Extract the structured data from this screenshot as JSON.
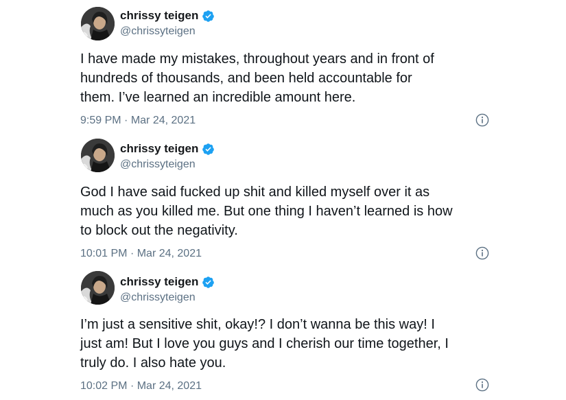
{
  "colors": {
    "verified_badge": "#1da1f2",
    "handle_gray": "#5b7083",
    "text": "#0f1419"
  },
  "tweets": [
    {
      "display_name": "chrissy teigen",
      "handle": "@chrissyteigen",
      "text": "I have made my mistakes, throughout years and in front of\nhundreds of thousands, and been held accountable for\nthem. I’ve learned an incredible amount here.",
      "time": "9:59 PM",
      "date": "Mar 24, 2021",
      "separator": "·",
      "verified_icon": "verified-badge-icon",
      "info_icon": "info-icon"
    },
    {
      "display_name": "chrissy teigen",
      "handle": "@chrissyteigen",
      "text": "God I have said fucked up shit and killed myself over it as\nmuch as you killed me. But one thing I haven’t learned is how\nto block out the negativity.",
      "time": "10:01 PM",
      "date": "Mar 24, 2021",
      "separator": "·",
      "verified_icon": "verified-badge-icon",
      "info_icon": "info-icon"
    },
    {
      "display_name": "chrissy teigen",
      "handle": "@chrissyteigen",
      "text": "I’m just a sensitive shit, okay!? I don’t wanna be this way! I\njust am! But I love you guys and I cherish our time together, I\ntruly do. I also hate you.",
      "time": "10:02 PM",
      "date": "Mar 24, 2021",
      "separator": "·",
      "verified_icon": "verified-badge-icon",
      "info_icon": "info-icon"
    }
  ]
}
